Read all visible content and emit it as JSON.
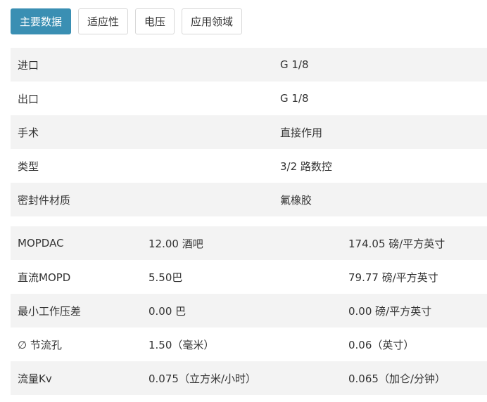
{
  "tabs": [
    {
      "label": "主要数据",
      "active": true
    },
    {
      "label": "适应性",
      "active": false
    },
    {
      "label": "电压",
      "active": false
    },
    {
      "label": "应用领域",
      "active": false
    }
  ],
  "main_table": [
    {
      "label": "进口",
      "value": "G 1/8"
    },
    {
      "label": "出口",
      "value": "G 1/8"
    },
    {
      "label": "手术",
      "value": "直接作用"
    },
    {
      "label": "类型",
      "value": "3/2 路数控"
    },
    {
      "label": "密封件材质",
      "value": "氟橡胶"
    }
  ],
  "specs_table": [
    {
      "label": "MOPDAC",
      "metric": "12.00 酒吧",
      "imperial": "174.05 磅/平方英寸"
    },
    {
      "label": "直流MOPD",
      "metric": "5.50巴",
      "imperial": "79.77 磅/平方英寸"
    },
    {
      "label": "最小工作压差",
      "metric": "0.00 巴",
      "imperial": "0.00 磅/平方英寸"
    },
    {
      "label": "∅ 节流孔",
      "metric": "1.50（毫米）",
      "imperial": "0.06（英寸）"
    },
    {
      "label": "流量Kv",
      "metric": "0.075（立方米/小时）",
      "imperial": "0.065（加仑/分钟）"
    }
  ]
}
